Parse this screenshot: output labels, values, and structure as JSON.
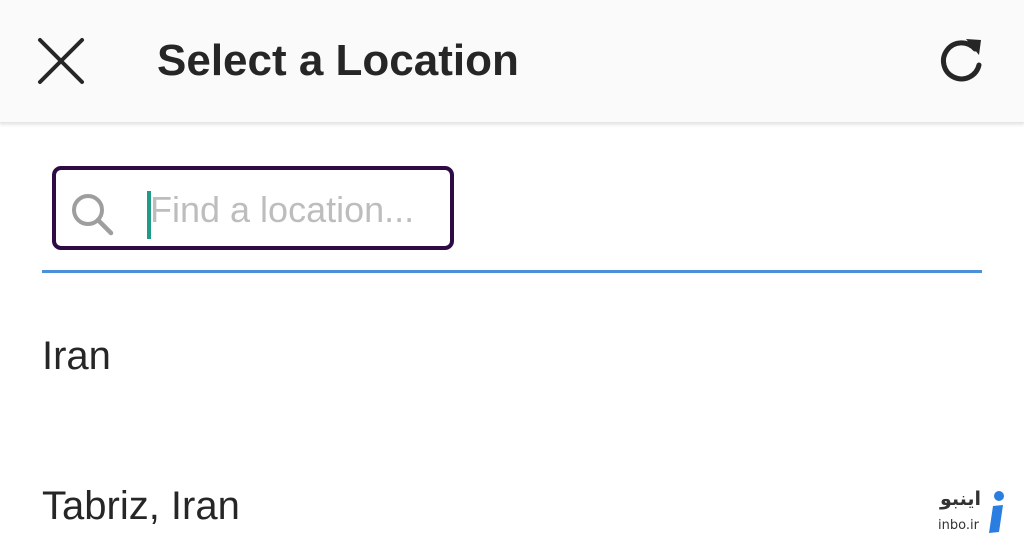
{
  "header": {
    "title": "Select a Location",
    "close_icon": "close-icon",
    "refresh_icon": "refresh-icon",
    "background": "#fafafa"
  },
  "search": {
    "placeholder": "Find a location...",
    "value": "",
    "icon": "search-icon",
    "border_color": "#2f0b45",
    "underline_color": "#4a90d9",
    "caret_color": "#1f9b87"
  },
  "results": [
    {
      "label": "Iran"
    },
    {
      "label": "Tabriz, Iran"
    }
  ],
  "watermark": {
    "persian_text": "اینبو",
    "site": "inbo.ir",
    "logo_icon": "inbo-logo-icon",
    "logo_color": "#2a7de1"
  }
}
